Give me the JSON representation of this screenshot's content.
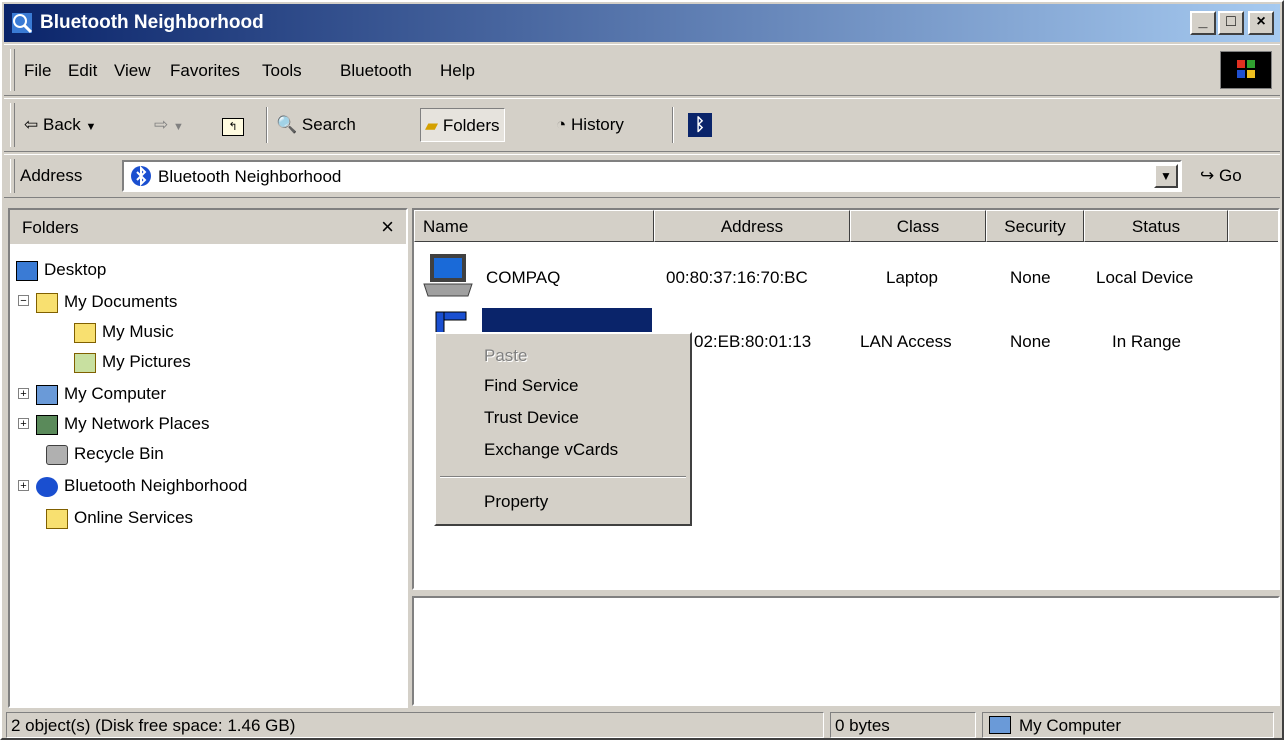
{
  "window": {
    "title": "Bluetooth Neighborhood",
    "minimize": "_",
    "maximize": "□",
    "close": "×"
  },
  "menubar": {
    "items": [
      "File",
      "Edit",
      "View",
      "Favorites",
      "Tools",
      "Bluetooth",
      "Help"
    ]
  },
  "toolbar": {
    "back": "Back",
    "search": "Search",
    "folders": "Folders",
    "history": "History"
  },
  "address": {
    "label": "Address",
    "value": "Bluetooth Neighborhood",
    "go": "Go"
  },
  "folders_pane": {
    "title": "Folders",
    "close": "×",
    "items": [
      "Desktop",
      "My Documents",
      "My Music",
      "My Pictures",
      "My Computer",
      "My Network Places",
      "Recycle Bin",
      "Bluetooth Neighborhood",
      "Online Services"
    ]
  },
  "list": {
    "columns": [
      "Name",
      "Address",
      "Class",
      "Security",
      "Status"
    ],
    "rows": [
      {
        "name": "COMPAQ",
        "address": "00:80:37:16:70:BC",
        "class": "Laptop",
        "security": "None",
        "status": "Local Device"
      },
      {
        "name": "",
        "address": "02:EB:80:01:13",
        "class": "LAN Access",
        "security": "None",
        "status": "In Range"
      }
    ]
  },
  "context_menu": {
    "items": [
      "Paste",
      "Find Service",
      "Trust Device",
      "Exchange vCards",
      "Property"
    ]
  },
  "statusbar": {
    "objects": "2 object(s) (Disk free space: 1.46 GB)",
    "size": "0 bytes",
    "location": "My Computer"
  },
  "colors": {
    "title_start": "#0a246a",
    "title_end": "#a6caf0",
    "face": "#d4d0c8",
    "selection": "#0a246a"
  }
}
